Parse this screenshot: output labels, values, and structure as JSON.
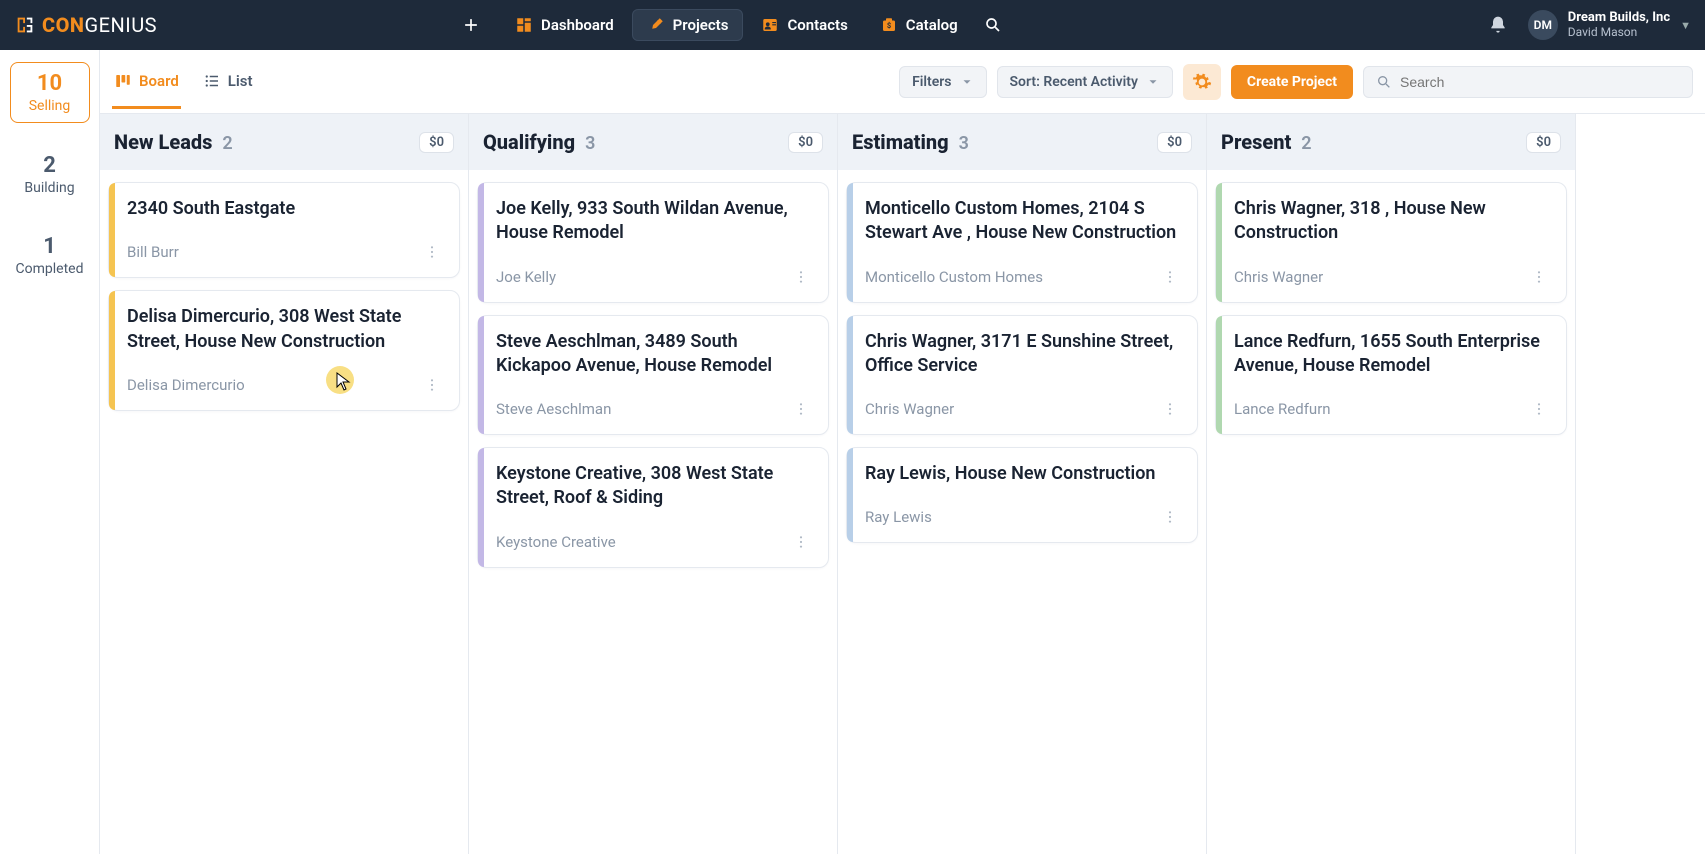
{
  "brand": {
    "con": "CON",
    "genius": "GENIUS"
  },
  "nav": {
    "dashboard": "Dashboard",
    "projects": "Projects",
    "contacts": "Contacts",
    "catalog": "Catalog"
  },
  "account": {
    "initials": "DM",
    "company": "Dream Builds, Inc",
    "user": "David Mason"
  },
  "sidebar": {
    "items": [
      {
        "count": "10",
        "label": "Selling"
      },
      {
        "count": "2",
        "label": "Building"
      },
      {
        "count": "1",
        "label": "Completed"
      }
    ]
  },
  "toolbar": {
    "board": "Board",
    "list": "List",
    "filters": "Filters",
    "sort": "Sort: Recent Activity",
    "create": "Create Project",
    "search_placeholder": "Search"
  },
  "columns": [
    {
      "title": "New Leads",
      "count": "2",
      "amount": "$0",
      "color": "yellow",
      "cards": [
        {
          "title": "2340 South Eastgate",
          "contact": "Bill Burr"
        },
        {
          "title": "Delisa Dimercurio, 308 West State Street, House New Construction",
          "contact": "Delisa Dimercurio"
        }
      ]
    },
    {
      "title": "Qualifying",
      "count": "3",
      "amount": "$0",
      "color": "purple",
      "cards": [
        {
          "title": "Joe Kelly, 933 South Wildan Avenue, House Remodel",
          "contact": "Joe Kelly"
        },
        {
          "title": "Steve Aeschlman, 3489 South Kickapoo Avenue, House Remodel",
          "contact": "Steve Aeschlman"
        },
        {
          "title": "Keystone Creative, 308 West State Street, Roof & Siding",
          "contact": "Keystone Creative"
        }
      ]
    },
    {
      "title": "Estimating",
      "count": "3",
      "amount": "$0",
      "color": "blue",
      "cards": [
        {
          "title": "Monticello Custom Homes, 2104 S Stewart Ave , House New Construction",
          "contact": "Monticello Custom Homes"
        },
        {
          "title": "Chris Wagner, 3171 E Sunshine Street, Office Service",
          "contact": "Chris Wagner"
        },
        {
          "title": "Ray Lewis, House New Construction",
          "contact": "Ray Lewis"
        }
      ]
    },
    {
      "title": "Present",
      "count": "2",
      "amount": "$0",
      "color": "green",
      "cards": [
        {
          "title": "Chris Wagner, 318 , House New Construction",
          "contact": "Chris Wagner"
        },
        {
          "title": "Lance Redfurn, 1655 South Enterprise Avenue, House Remodel",
          "contact": "Lance Redfurn"
        }
      ]
    }
  ]
}
